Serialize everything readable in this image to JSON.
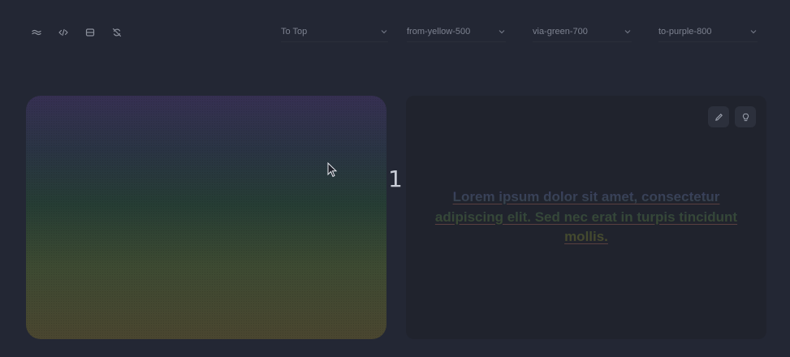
{
  "toolbar": {
    "icons": [
      "wave-icon",
      "code-icon",
      "storage-icon",
      "refresh-off-icon"
    ],
    "selects": [
      {
        "value": "To Top"
      },
      {
        "value": "from-yellow-500"
      },
      {
        "value": "via-green-700"
      },
      {
        "value": "to-purple-800"
      }
    ]
  },
  "step_number": "1",
  "text_panel": {
    "lorem": "Lorem ipsum dolor sit amet, consectetur adipiscing elit. Sed nec erat in turpis tincidunt mollis.",
    "buttons": [
      "edit-icon",
      "lightbulb-icon"
    ]
  },
  "colors": {
    "background": "#232734",
    "panel": "#20232d",
    "gradient_from": "#4a4630",
    "gradient_via": "#263d34",
    "gradient_to": "#363052"
  }
}
